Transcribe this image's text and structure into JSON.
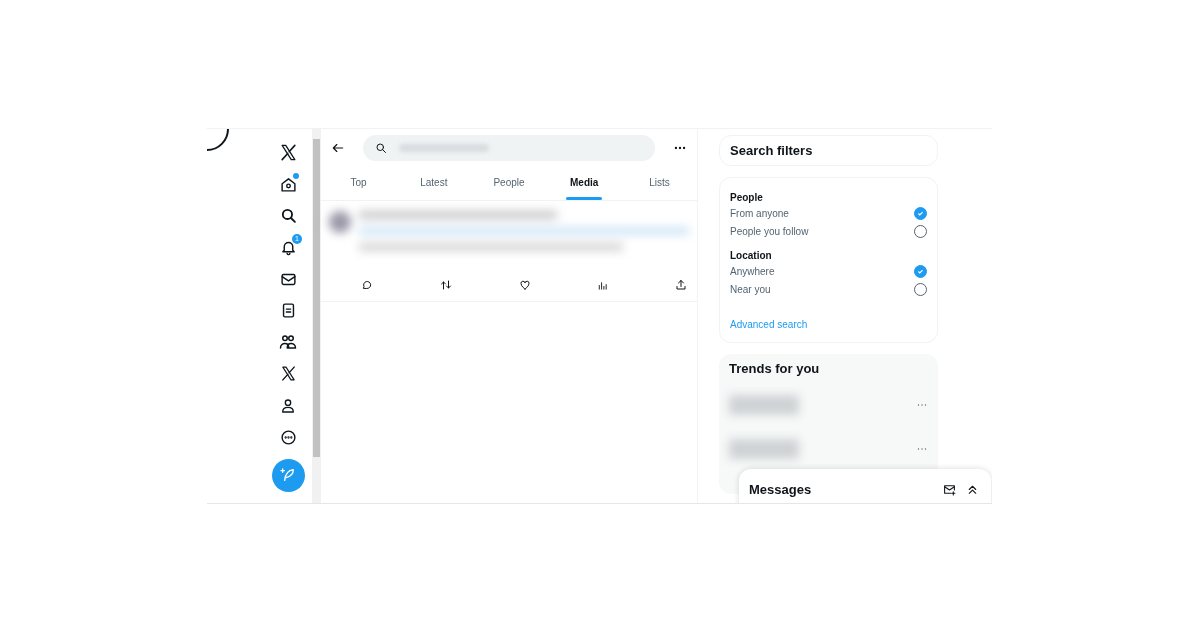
{
  "sidebar": {
    "notification_badge": "1"
  },
  "tabs": [
    {
      "label": "Top",
      "selected": false
    },
    {
      "label": "Latest",
      "selected": false
    },
    {
      "label": "People",
      "selected": false
    },
    {
      "label": "Media",
      "selected": true
    },
    {
      "label": "Lists",
      "selected": false
    }
  ],
  "search_filters": {
    "title": "Search filters",
    "sections": [
      {
        "heading": "People",
        "options": [
          {
            "label": "From anyone",
            "selected": true
          },
          {
            "label": "People you follow",
            "selected": false
          }
        ]
      },
      {
        "heading": "Location",
        "options": [
          {
            "label": "Anywhere",
            "selected": true
          },
          {
            "label": "Near you",
            "selected": false
          }
        ]
      }
    ],
    "link": "Advanced search"
  },
  "trends": {
    "title": "Trends for you"
  },
  "messages": {
    "title": "Messages"
  }
}
